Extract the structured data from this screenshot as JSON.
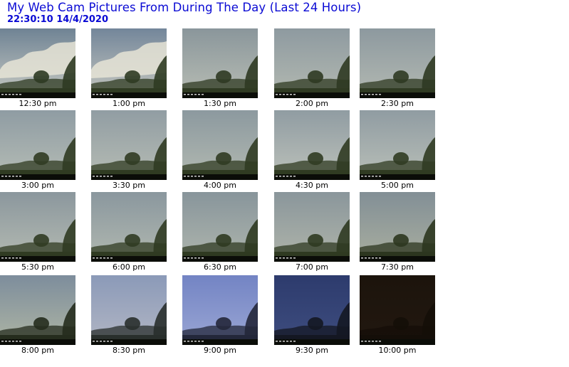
{
  "page": {
    "title": "My Web Cam Pictures From During The Day (Last 24 Hours)",
    "timestamp": "22:30:10  14/4/2020",
    "title_color": "#0a0ad4"
  },
  "thumbnails": [
    {
      "time": "12:30 pm",
      "sky_top": "#6f8394",
      "sky_bottom": "#c9cbc4",
      "ground": "#2e3a22",
      "clouds": true
    },
    {
      "time": "1:00 pm",
      "sky_top": "#73869a",
      "sky_bottom": "#c7c8c0",
      "ground": "#2f3b22",
      "clouds": true
    },
    {
      "time": "1:30 pm",
      "sky_top": "#8a969b",
      "sky_bottom": "#b8bdb4",
      "ground": "#2f3a22",
      "clouds": false
    },
    {
      "time": "2:00 pm",
      "sky_top": "#8e9aa0",
      "sky_bottom": "#b3b9b1",
      "ground": "#2f3a22",
      "clouds": false
    },
    {
      "time": "2:30 pm",
      "sky_top": "#8d999f",
      "sky_bottom": "#b3b9b2",
      "ground": "#2f3a22",
      "clouds": false
    },
    {
      "time": "3:00 pm",
      "sky_top": "#8f9ca3",
      "sky_bottom": "#b5bcb5",
      "ground": "#303b22",
      "clouds": false
    },
    {
      "time": "3:30 pm",
      "sky_top": "#919da3",
      "sky_bottom": "#b6bcb4",
      "ground": "#303b22",
      "clouds": false
    },
    {
      "time": "4:00 pm",
      "sky_top": "#8c999f",
      "sky_bottom": "#b2b9b1",
      "ground": "#303b22",
      "clouds": false
    },
    {
      "time": "4:30 pm",
      "sky_top": "#909ca2",
      "sky_bottom": "#bcc1ba",
      "ground": "#303b22",
      "clouds": false
    },
    {
      "time": "5:00 pm",
      "sky_top": "#909ca2",
      "sky_bottom": "#b9bfb8",
      "ground": "#303b22",
      "clouds": false
    },
    {
      "time": "5:30 pm",
      "sky_top": "#8b979d",
      "sky_bottom": "#b4bab2",
      "ground": "#303b22",
      "clouds": false
    },
    {
      "time": "6:00 pm",
      "sky_top": "#8a979e",
      "sky_bottom": "#b1b8b0",
      "ground": "#303b22",
      "clouds": false
    },
    {
      "time": "6:30 pm",
      "sky_top": "#88959b",
      "sky_bottom": "#aeb5ad",
      "ground": "#2f3a21",
      "clouds": false
    },
    {
      "time": "7:00 pm",
      "sky_top": "#8a969b",
      "sky_bottom": "#afb4aa",
      "ground": "#2f3a21",
      "clouds": false
    },
    {
      "time": "7:30 pm",
      "sky_top": "#828f96",
      "sky_bottom": "#a9ae9f",
      "ground": "#2c361f",
      "clouds": false
    },
    {
      "time": "8:00 pm",
      "sky_top": "#7d8d9c",
      "sky_bottom": "#aeb5a4",
      "ground": "#252c1d",
      "clouds": false
    },
    {
      "time": "8:30 pm",
      "sky_top": "#8b9ab8",
      "sky_bottom": "#b2b6c4",
      "ground": "#292f2c",
      "clouds": false
    },
    {
      "time": "9:00 pm",
      "sky_top": "#7384c4",
      "sky_bottom": "#9aa6d4",
      "ground": "#23273a",
      "clouds": false
    },
    {
      "time": "9:30 pm",
      "sky_top": "#2d3b6d",
      "sky_bottom": "#3e4d7f",
      "ground": "#141722",
      "clouds": false
    },
    {
      "time": "10:00 pm",
      "sky_top": "#1c140c",
      "sky_bottom": "#221810",
      "ground": "#140e08",
      "clouds": false
    }
  ]
}
